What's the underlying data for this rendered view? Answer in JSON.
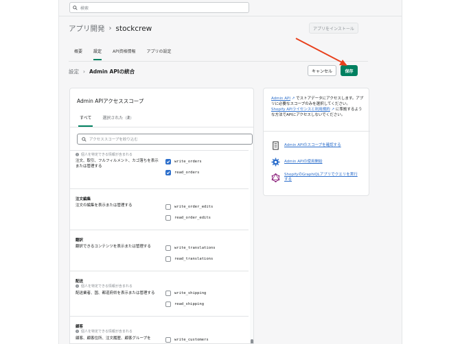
{
  "search": {
    "placeholder": "検索",
    "icon": "search-icon"
  },
  "header": {
    "breadcrumb_parent": "アプリ開発",
    "app_name": "stockcrew",
    "install_button": "アプリをインストール"
  },
  "tabs": [
    {
      "label": "概要",
      "active": false
    },
    {
      "label": "設定",
      "active": true
    },
    {
      "label": "API資格情報",
      "active": false
    },
    {
      "label": "アプリの設定",
      "active": false
    }
  ],
  "subheader": {
    "parent": "設定",
    "current": "Admin APIの統合",
    "cancel_button": "キャンセル",
    "save_button": "保存"
  },
  "scopes_card": {
    "title": "Admin APIアクセススコープ",
    "tab_all": "すべて",
    "tab_selected": "選択された",
    "selected_count": "2",
    "filter_placeholder": "アクセススコープを絞り込む",
    "sections": [
      {
        "heading": "",
        "note": "個人を特定できる情報が含まれる",
        "desc": "注文、取引、フルフィルメント、カゴ落ちを表示または管理する",
        "scopes": [
          {
            "name": "write_orders",
            "checked": true
          },
          {
            "name": "read_orders",
            "checked": true
          }
        ]
      },
      {
        "heading": "注文編集",
        "note": "",
        "desc": "注文の編集を表示または管理する",
        "scopes": [
          {
            "name": "write_order_edits",
            "checked": false
          },
          {
            "name": "read_order_edits",
            "checked": false
          }
        ]
      },
      {
        "heading": "翻訳",
        "note": "",
        "desc": "翻訳できるコンテンツを表示または管理する",
        "scopes": [
          {
            "name": "write_translations",
            "checked": false
          },
          {
            "name": "read_translations",
            "checked": false
          }
        ]
      },
      {
        "heading": "配送",
        "note": "個人を特定できる情報が含まれる",
        "desc": "配送業者、国、都道府県を表示または管理する",
        "scopes": [
          {
            "name": "write_shipping",
            "checked": false
          },
          {
            "name": "read_shipping",
            "checked": false
          }
        ]
      },
      {
        "heading": "顧客",
        "note": "個人を特定できる情報が含まれる",
        "desc": "顧客、顧客住所、注文履歴、顧客グループを",
        "scopes": [
          {
            "name": "write_customers",
            "checked": false
          }
        ]
      }
    ]
  },
  "info_card": {
    "intro_link": "Admin API",
    "intro_text": "でストアデータにアクセスします。アプリに必要なスコープのみを選択してください。",
    "license_link": "Shopify APIライセンスと利用規約",
    "license_text": "に準拠するような方法でAPIにアクセスしないでください。",
    "links": [
      {
        "label": "Admin APIのスコープを確認する",
        "icon": "document-icon"
      },
      {
        "label": "Admin APIの使用開始",
        "icon": "gear-icon"
      },
      {
        "label": "ShopifyのGraphiQLアプリでクエリを実行する",
        "icon": "graphql-icon"
      }
    ]
  },
  "colors": {
    "accent": "#008060",
    "link": "#2c6ecb",
    "annotation_arrow": "#e8401c"
  }
}
